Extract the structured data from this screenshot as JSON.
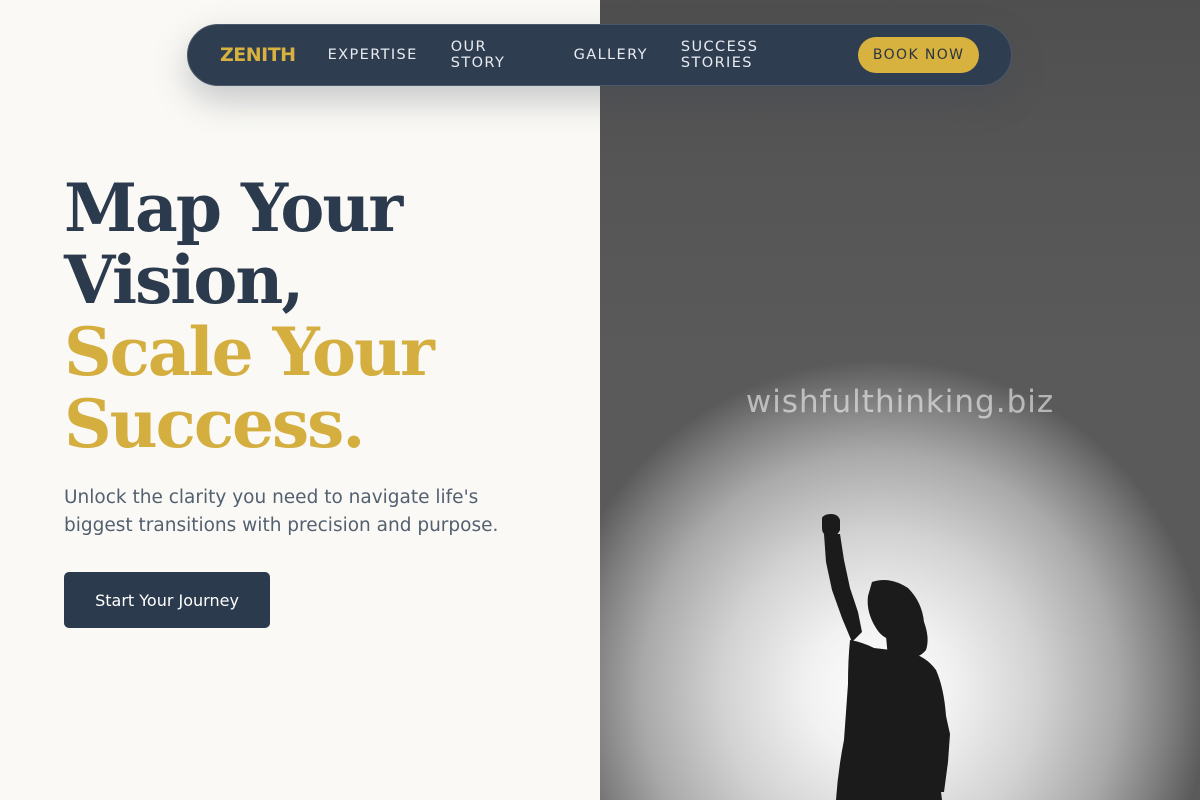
{
  "brand": {
    "name": "ZENITH",
    "accent": "#d8b23e",
    "navy": "#2c3a4d"
  },
  "nav": {
    "links": [
      "EXPERTISE",
      "OUR STORY",
      "GALLERY",
      "SUCCESS STORIES"
    ],
    "book_label": "BOOK NOW"
  },
  "hero": {
    "headline_line1": "Map Your",
    "headline_line2": "Vision,",
    "headline_line3": "Scale Your",
    "headline_line4": "Success.",
    "subtitle": "Unlock the clarity you need to navigate life's biggest transitions with precision and purpose.",
    "cta_label": "Start Your Journey"
  },
  "image": {
    "watermark": "wishfulthinking.biz",
    "subject_icon": "raised-fist-silhouette"
  }
}
